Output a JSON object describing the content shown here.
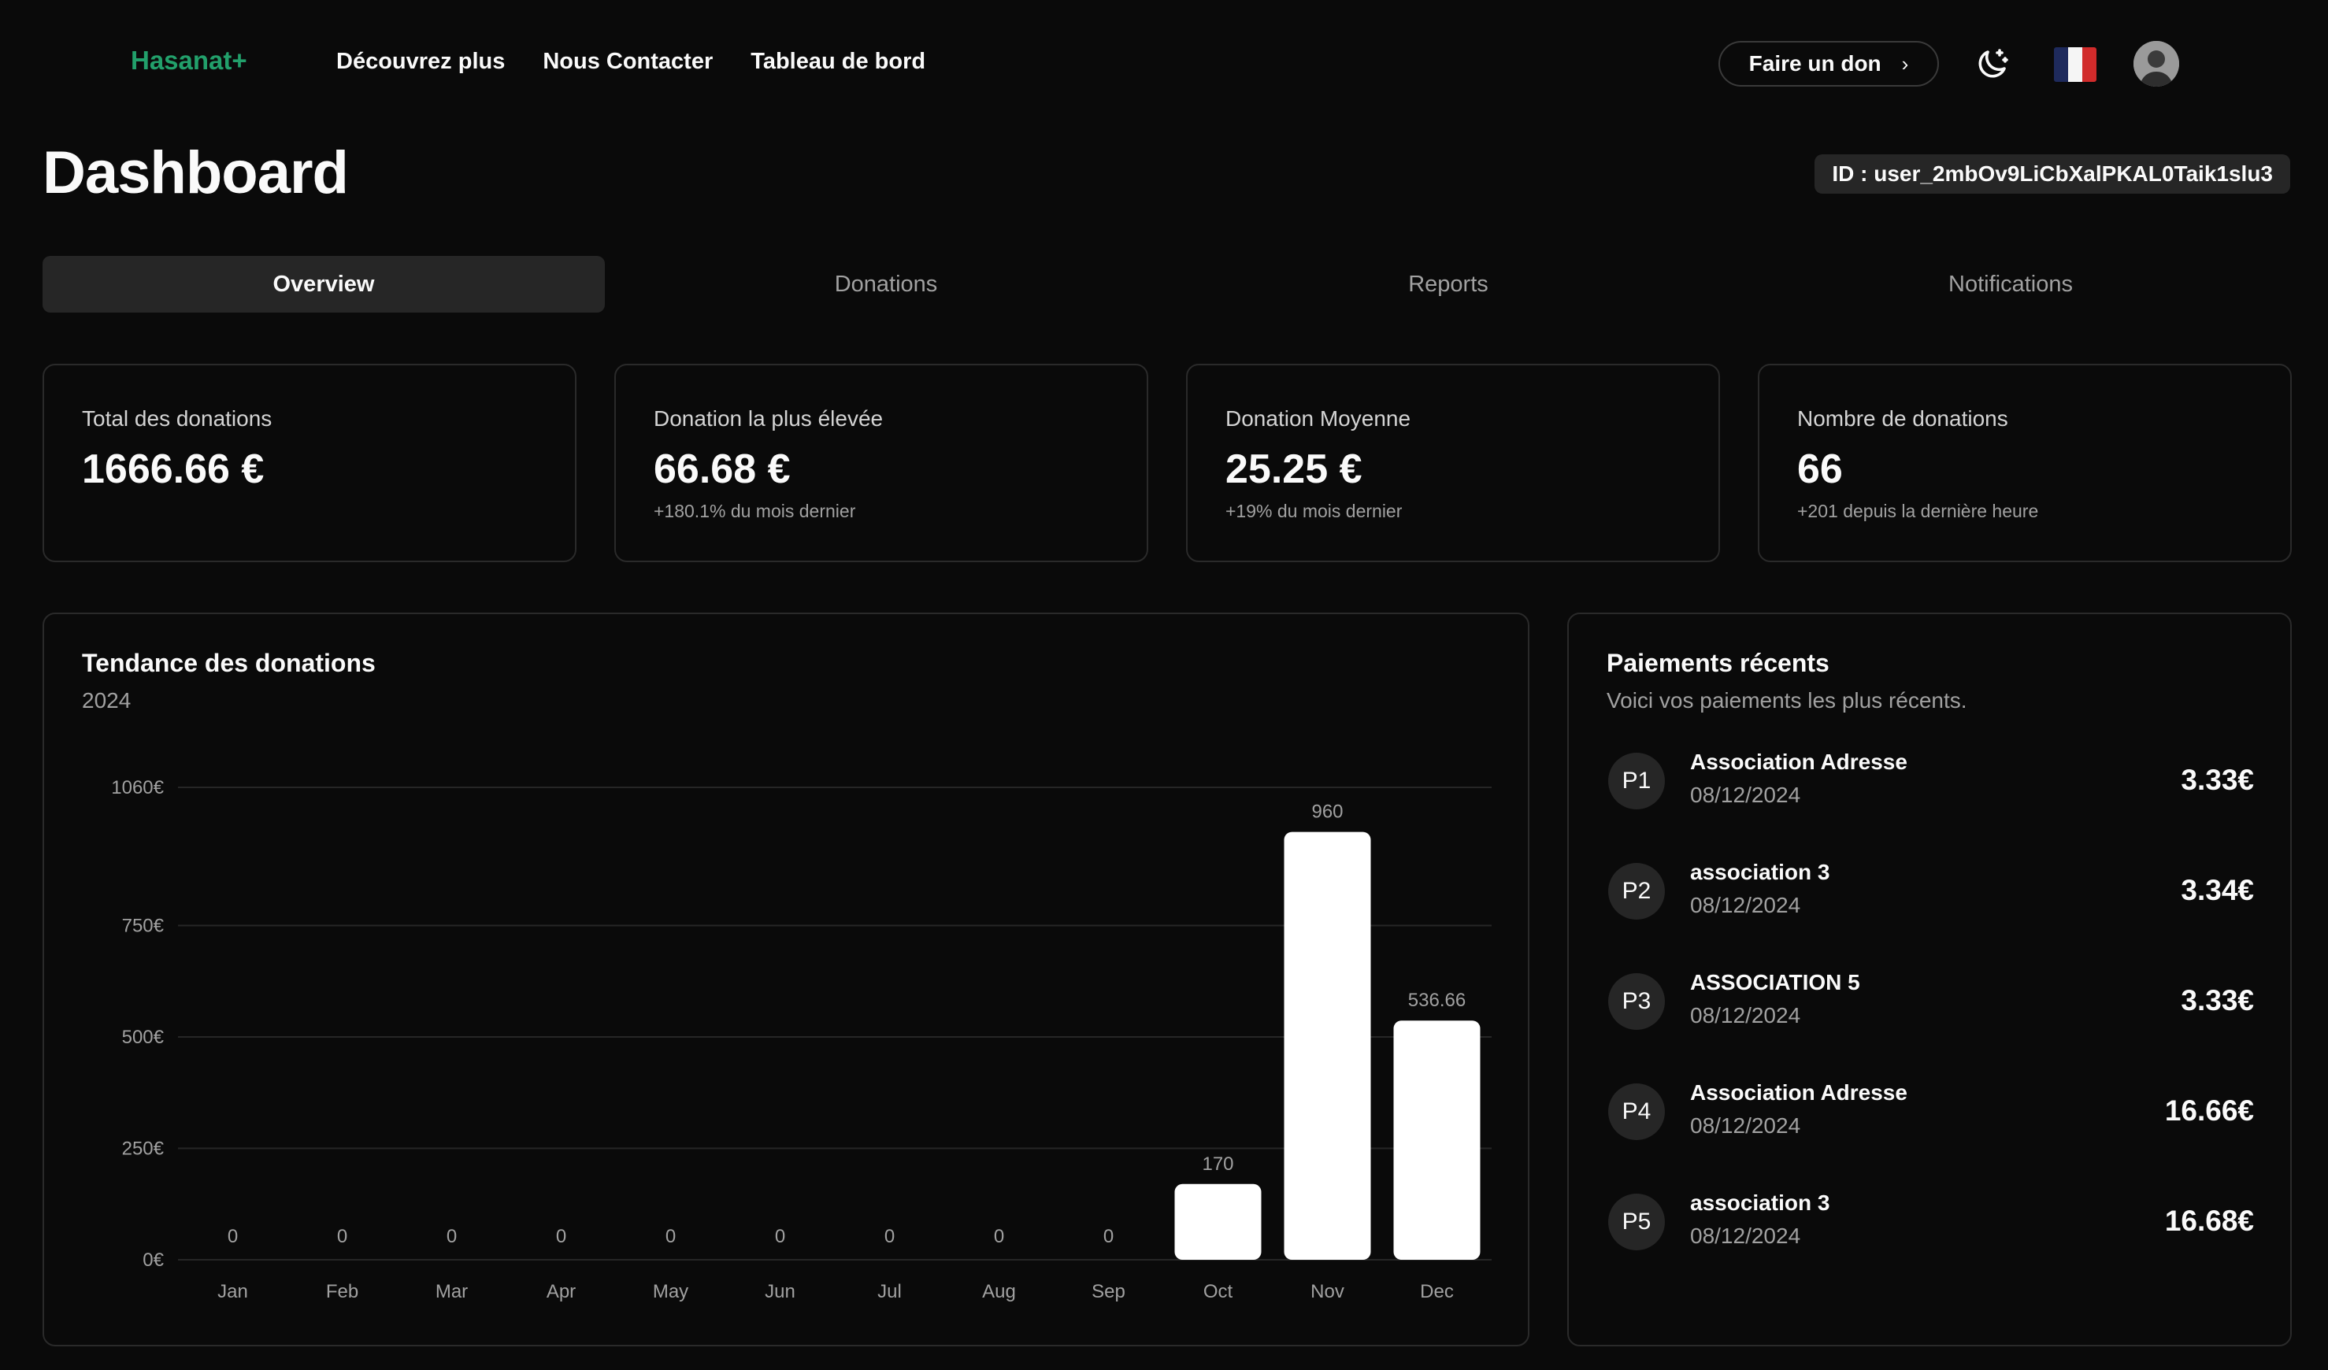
{
  "header": {
    "logo": "Hasanat+",
    "nav": [
      "Découvrez plus",
      "Nous Contacter",
      "Tableau de bord"
    ],
    "donate_label": "Faire un don",
    "theme_icon": "moon-stars-icon",
    "language_flag": "fr-flag-icon",
    "flag_colors": [
      "#1e2a5c",
      "#f5f5f5",
      "#d12b2b"
    ]
  },
  "page": {
    "title": "Dashboard",
    "user_id": "ID : user_2mbOv9LiCbXalPKAL0Taik1slu3"
  },
  "tabs": [
    {
      "label": "Overview",
      "active": true
    },
    {
      "label": "Donations",
      "active": false
    },
    {
      "label": "Reports",
      "active": false
    },
    {
      "label": "Notifications",
      "active": false
    }
  ],
  "stats": [
    {
      "label": "Total des donations",
      "value": "1666.66 €",
      "sub": ""
    },
    {
      "label": "Donation la plus élevée",
      "value": "66.68 €",
      "sub": "+180.1% du mois dernier"
    },
    {
      "label": "Donation Moyenne",
      "value": "25.25 €",
      "sub": "+19% du mois dernier"
    },
    {
      "label": "Nombre de donations",
      "value": "66",
      "sub": "+201 depuis la dernière heure"
    }
  ],
  "chart_data": {
    "type": "bar",
    "title": "Tendance des donations",
    "subtitle": "2024",
    "categories": [
      "Jan",
      "Feb",
      "Mar",
      "Apr",
      "May",
      "Jun",
      "Jul",
      "Aug",
      "Sep",
      "Oct",
      "Nov",
      "Dec"
    ],
    "values": [
      0,
      0,
      0,
      0,
      0,
      0,
      0,
      0,
      0,
      170,
      960,
      536.66
    ],
    "value_labels": [
      "0",
      "0",
      "0",
      "0",
      "0",
      "0",
      "0",
      "0",
      "0",
      "170",
      "960",
      "536.66"
    ],
    "y_ticks": [
      {
        "value": 0,
        "label": "0€"
      },
      {
        "value": 250,
        "label": "250€"
      },
      {
        "value": 500,
        "label": "500€"
      },
      {
        "value": 750,
        "label": "750€"
      },
      {
        "value": 1060,
        "label": "1060€"
      }
    ],
    "ylim": [
      0,
      1060
    ],
    "grid": true,
    "bar_color": "#ffffff"
  },
  "payments": {
    "title": "Paiements récents",
    "subtitle": "Voici vos paiements les plus récents.",
    "items": [
      {
        "badge": "P1",
        "name": "Association Adresse",
        "date": "08/12/2024",
        "amount": "3.33€"
      },
      {
        "badge": "P2",
        "name": "association 3",
        "date": "08/12/2024",
        "amount": "3.34€"
      },
      {
        "badge": "P3",
        "name": "ASSOCIATION 5",
        "date": "08/12/2024",
        "amount": "3.33€"
      },
      {
        "badge": "P4",
        "name": "Association Adresse",
        "date": "08/12/2024",
        "amount": "16.66€"
      },
      {
        "badge": "P5",
        "name": "association 3",
        "date": "08/12/2024",
        "amount": "16.68€"
      }
    ]
  }
}
